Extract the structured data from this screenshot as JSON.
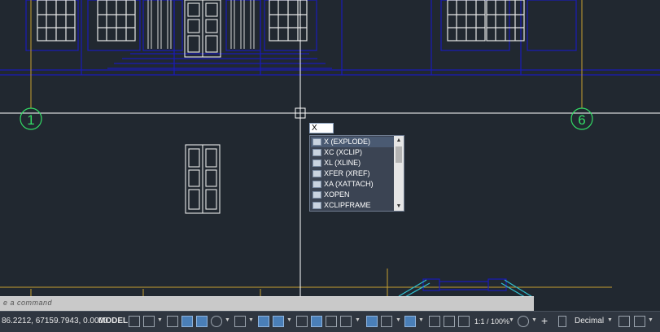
{
  "drawing": {
    "grid_bubble_left": "1",
    "grid_bubble_right": "6"
  },
  "command": {
    "input_value": "X",
    "prompt": "e a command"
  },
  "autocomplete": {
    "items": [
      {
        "label": "X (EXPLODE)",
        "icon": "explode-icon"
      },
      {
        "label": "XC (XCLIP)",
        "icon": "xclip-icon"
      },
      {
        "label": "XL (XLINE)",
        "icon": "xline-icon"
      },
      {
        "label": "XFER (XREF)",
        "icon": "xref-icon"
      },
      {
        "label": "XA (XATTACH)",
        "icon": "xattach-icon"
      },
      {
        "label": "XOPEN",
        "icon": "xopen-icon"
      },
      {
        "label": "XCLIPFRAME",
        "icon": "xclipframe-icon"
      }
    ],
    "scroll_up": "▲",
    "scroll_down": "▼"
  },
  "statusbar": {
    "coordinates": "86.2212, 67159.7943, 0.0000",
    "model_label": "MODEL",
    "scale": "1:1 / 100%",
    "units": "Decimal"
  },
  "colors": {
    "background": "#212830",
    "building_lines": "#1a1ab8",
    "window_white": "#e8e8e8",
    "grid_axis": "#c8a030",
    "grid_bubble": "#33dd66",
    "crosshair": "#ffffff"
  }
}
